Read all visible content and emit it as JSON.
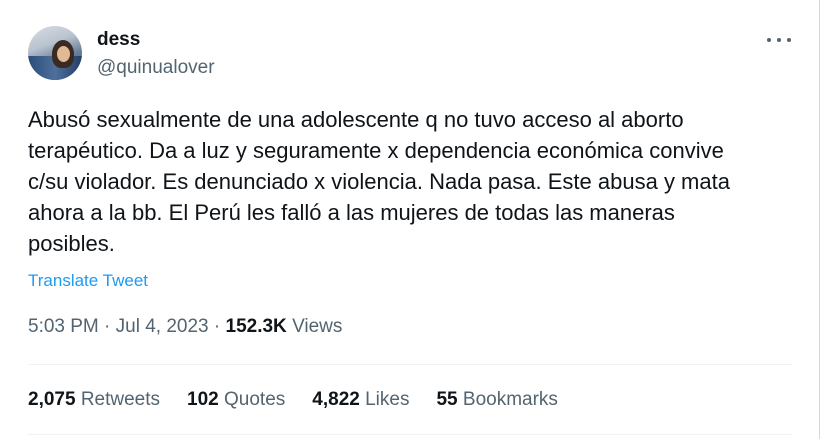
{
  "user": {
    "display_name": "dess",
    "handle": "@quinualover"
  },
  "tweet": {
    "text_lines": [
      "Abusó sexualmente de una adolescente q no tuvo acceso al aborto",
      "terapéutico. Da a luz y seguramente x dependencia económica convive",
      "c/su violador. Es denunciado x violencia. Nada pasa. Este abusa y mata",
      "ahora a la bb. El Perú les falló a las mujeres de todas las maneras",
      "posibles."
    ],
    "translate_label": "Translate Tweet",
    "time": "5:03 PM",
    "date": "Jul 4, 2023",
    "views_count": "152.3K",
    "views_label": "Views"
  },
  "stats": [
    {
      "count": "2,075",
      "label": "Retweets"
    },
    {
      "count": "102",
      "label": "Quotes"
    },
    {
      "count": "4,822",
      "label": "Likes"
    },
    {
      "count": "55",
      "label": "Bookmarks"
    }
  ],
  "icons": {
    "more": "more-horizontal-icon",
    "avatar": "user-avatar"
  },
  "colors": {
    "link": "#1d9bf0",
    "secondary_text": "#536471",
    "primary_text": "#0f1419"
  }
}
